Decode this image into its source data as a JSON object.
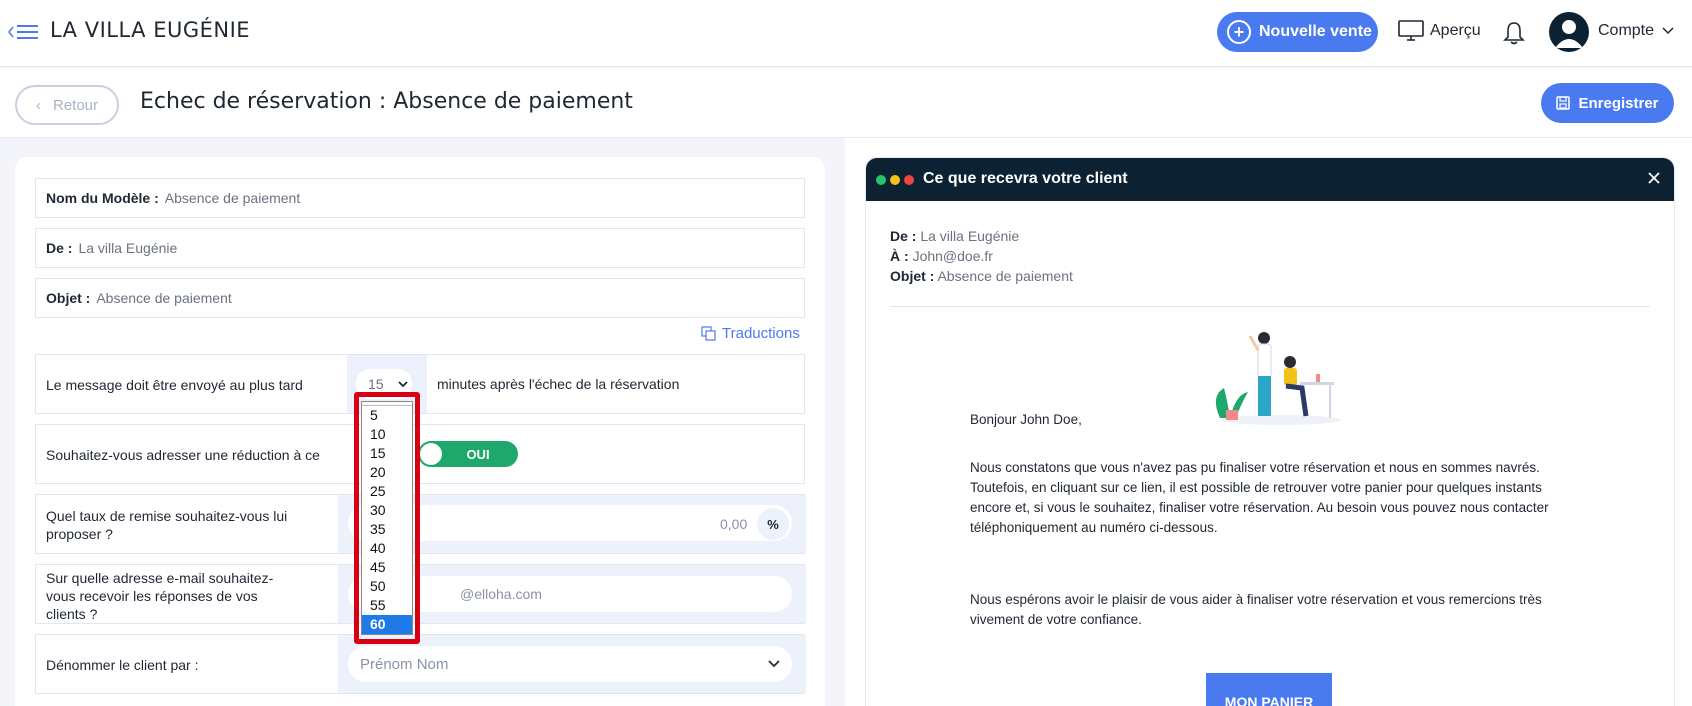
{
  "header": {
    "brand": "LA VILLA EUGÉNIE",
    "new_sale_label": "Nouvelle vente",
    "preview_label": "Aperçu",
    "account_label": "Compte"
  },
  "subheader": {
    "back_label": "Retour",
    "title": "Echec de réservation : Absence de paiement",
    "save_label": "Enregistrer"
  },
  "form": {
    "model_name_label": "Nom du Modèle :",
    "model_name_value": "Absence de paiement",
    "from_label": "De :",
    "from_value": "La villa Eugénie",
    "subject_label": "Objet :",
    "subject_value": "Absence de paiement",
    "translations_label": "Traductions",
    "delay_question": "Le message doit être envoyé au plus tard",
    "delay_value": "15",
    "delay_suffix": "minutes après l'échec de la réservation",
    "discount_question": "Souhaitez-vous adresser une réduction à ce",
    "discount_toggle": "OUI",
    "rate_question_line1": "Quel taux de remise souhaitez-vous lui",
    "rate_question_line2": "proposer ?",
    "rate_value": "0,00",
    "rate_unit": "%",
    "email_question_line1": "Sur quelle adresse e-mail souhaitez-",
    "email_question_line2": "vous recevoir les réponses de vos",
    "email_question_line3": "clients ?",
    "email_value": "@elloha.com",
    "client_name_question": "Dénommer le client par :",
    "client_name_value": "Prénom Nom"
  },
  "dropdown": {
    "options": [
      "5",
      "10",
      "15",
      "20",
      "25",
      "30",
      "35",
      "40",
      "45",
      "50",
      "55",
      "60"
    ],
    "highlighted": "60"
  },
  "preview": {
    "title": "Ce que recevra votre client",
    "from_label": "De :",
    "from_value": "La villa Eugénie",
    "to_label": "À :",
    "to_value": "John@doe.fr",
    "subject_label": "Objet :",
    "subject_value": "Absence de paiement",
    "greeting": "Bonjour John Doe,",
    "paragraph1_l1": "Nous constatons que vous n'avez pas pu finaliser votre réservation et nous en sommes navrés.",
    "paragraph1_l2": "Toutefois, en cliquant sur ce lien, il est possible de retrouver votre panier pour quelques instants",
    "paragraph1_l3": "encore et, si vous le souhaitez, finaliser votre réservation. Au besoin vous pouvez nous contacter",
    "paragraph1_l4": "téléphoniquement au numéro ci-dessous.",
    "paragraph2_l1": "Nous espérons avoir le plaisir de vous aider à finaliser votre réservation et vous remercions très",
    "paragraph2_l2": "vivement de votre confiance.",
    "cta_label": "MON PANIER"
  },
  "colors": {
    "accent": "#4a7af0",
    "dark": "#0c2233",
    "toggle_on": "#1fa86b",
    "highlight_frame": "#d60012",
    "dot_green": "#27c46b",
    "dot_yellow": "#f2c218",
    "dot_red": "#ee4444"
  }
}
